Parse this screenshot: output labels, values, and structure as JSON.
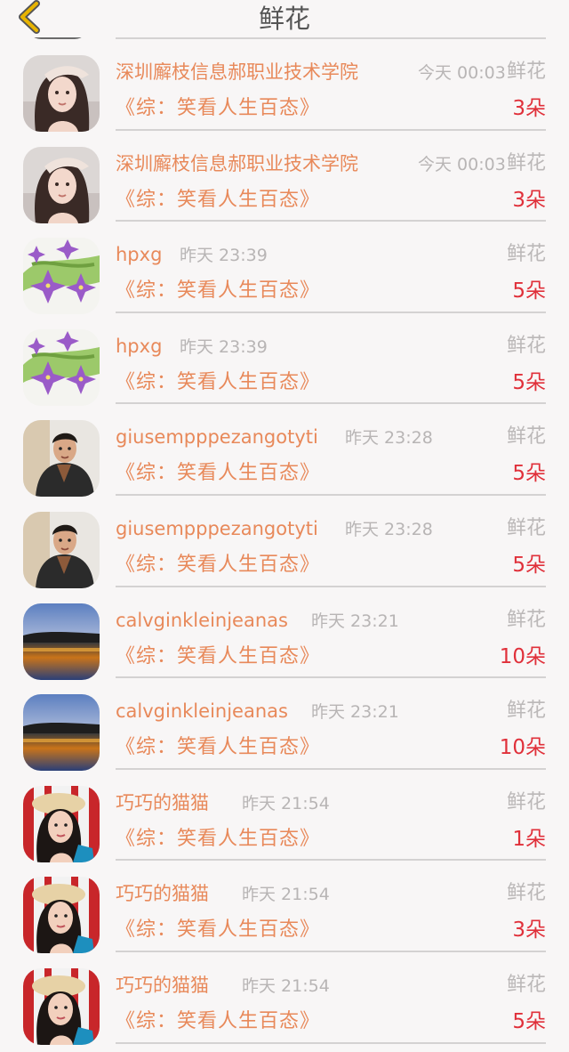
{
  "header": {
    "title": "鲜花",
    "back_icon": "chevron-left-icon",
    "back_color": "#e8b400"
  },
  "colors": {
    "name": "#e8895a",
    "time": "#b8b5b5",
    "count": "#e0303a",
    "divider": "#d4d2d2"
  },
  "list": {
    "items": [
      {
        "avatar": "avatar-woman-long-hair",
        "name": "深圳廨枝信息郝职业技术学院",
        "time": "今天 00:03",
        "gift": "鲜花",
        "work": "《综：笑看人生百态》",
        "count": "3朵"
      },
      {
        "avatar": "avatar-woman-long-hair",
        "name": "深圳廨枝信息郝职业技术学院",
        "time": "今天 00:03",
        "gift": "鲜花",
        "work": "《综：笑看人生百态》",
        "count": "3朵"
      },
      {
        "avatar": "avatar-purple-flowers",
        "name": "hpxg",
        "time": "昨天 23:39",
        "gift": "鲜花",
        "work": "《综：笑看人生百态》",
        "count": "5朵"
      },
      {
        "avatar": "avatar-purple-flowers",
        "name": "hpxg",
        "time": "昨天 23:39",
        "gift": "鲜花",
        "work": "《综：笑看人生百态》",
        "count": "5朵"
      },
      {
        "avatar": "avatar-man-jacket",
        "name": "giusempppezangotyti",
        "time": "昨天 23:28",
        "gift": "鲜花",
        "work": "《综：笑看人生百态》",
        "count": "5朵"
      },
      {
        "avatar": "avatar-man-jacket",
        "name": "giusempppezangotyti",
        "time": "昨天 23:28",
        "gift": "鲜花",
        "work": "《综：笑看人生百态》",
        "count": "5朵"
      },
      {
        "avatar": "avatar-lake-landscape",
        "name": "calvginkleinjeanas",
        "time": "昨天 23:21",
        "gift": "鲜花",
        "work": "《综：笑看人生百态》",
        "count": "10朵"
      },
      {
        "avatar": "avatar-lake-landscape",
        "name": "calvginkleinjeanas",
        "time": "昨天 23:21",
        "gift": "鲜花",
        "work": "《综：笑看人生百态》",
        "count": "10朵"
      },
      {
        "avatar": "avatar-woman-hat",
        "name": "巧巧的猫猫",
        "time": "昨天 21:54",
        "gift": "鲜花",
        "work": "《综：笑看人生百态》",
        "count": "1朵"
      },
      {
        "avatar": "avatar-woman-hat",
        "name": "巧巧的猫猫",
        "time": "昨天 21:54",
        "gift": "鲜花",
        "work": "《综：笑看人生百态》",
        "count": "3朵"
      },
      {
        "avatar": "avatar-woman-hat",
        "name": "巧巧的猫猫",
        "time": "昨天 21:54",
        "gift": "鲜花",
        "work": "《综：笑看人生百态》",
        "count": "5朵"
      }
    ]
  }
}
